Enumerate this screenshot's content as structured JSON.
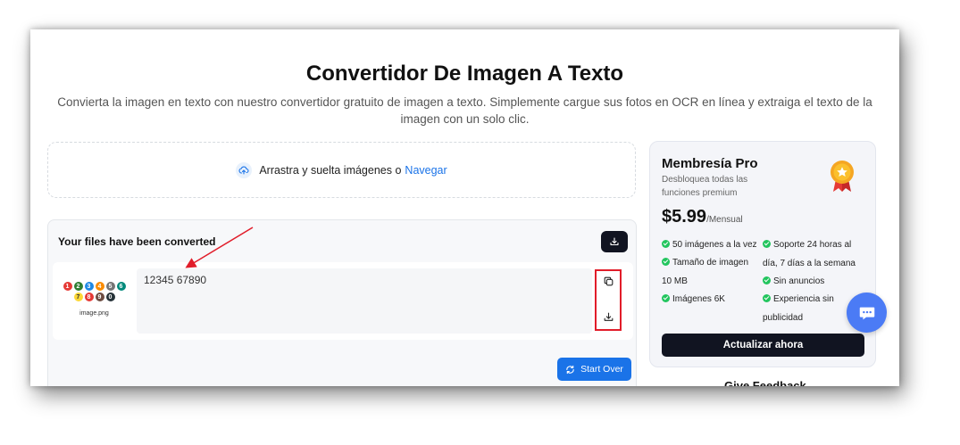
{
  "header": {
    "title": "Convertidor De Imagen A Texto",
    "subtitle": "Convierta la imagen en texto con nuestro convertidor gratuito de imagen a texto. Simplemente cargue sus fotos en OCR en línea y extraiga el texto de la imagen con un solo clic."
  },
  "upload": {
    "prompt": "Arrastra y suelta imágenes o",
    "browse_link": "Navegar"
  },
  "results": {
    "title": "Your files have been converted",
    "file": {
      "name": "image.png",
      "extracted_text": "12345 67890",
      "thumbnail_digits": [
        "1",
        "2",
        "3",
        "4",
        "5",
        "6",
        "7",
        "8",
        "9",
        "0"
      ]
    },
    "start_over_label": "Start Over"
  },
  "pro": {
    "title": "Membresía Pro",
    "description": "Desbloquea todas las funciones premium",
    "price": "$5.99",
    "period": "/Mensual",
    "features_left": [
      "50 imágenes a la vez",
      "Tamaño de imagen 10 MB",
      "Imágenes 6K"
    ],
    "features_right": [
      "Soporte 24 horas al día, 7 días a la semana",
      "Sin anuncios",
      "Experiencia sin publicidad"
    ],
    "upgrade_label": "Actualizar ahora"
  },
  "feedback": {
    "label": "Give Feedback"
  },
  "colors": {
    "accent": "#1a73e8",
    "dark": "#111421",
    "check": "#22c55e",
    "highlight_box": "#e11d2a",
    "chat": "#4b7bf5"
  }
}
